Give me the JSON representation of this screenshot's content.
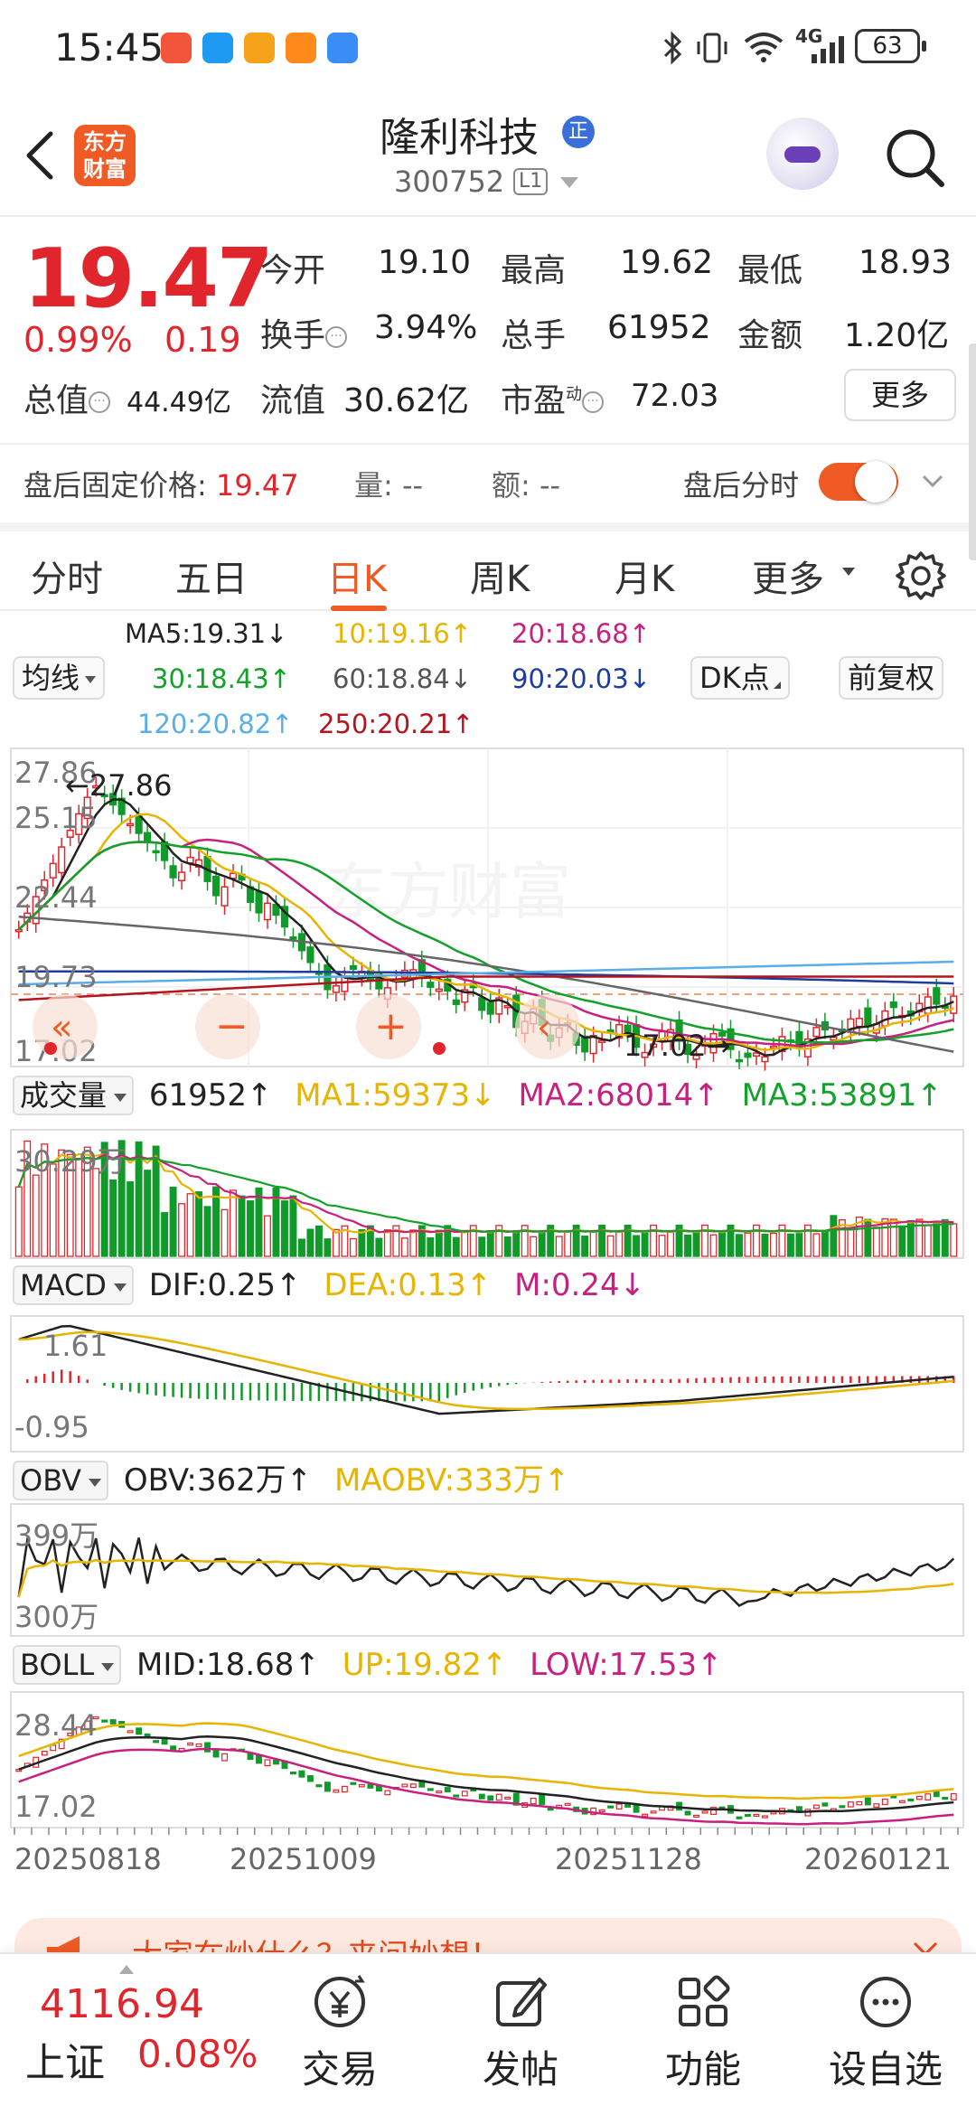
{
  "status_bar": {
    "time": "15:45",
    "network": "4G",
    "battery": "63"
  },
  "header": {
    "brand_logo": [
      "东方",
      "财富"
    ],
    "stock_name": "隆利科技",
    "badge": "正",
    "stock_code": "300752",
    "level": "L1"
  },
  "quote": {
    "price": "19.47",
    "change_pct": "0.99%",
    "change_abs": "0.19",
    "fields": [
      {
        "label": "今开",
        "value": "19.10",
        "color": "#109a2a"
      },
      {
        "label": "最高",
        "value": "19.62",
        "color": "#e0262c"
      },
      {
        "label": "最低",
        "value": "18.93",
        "color": "#109a2a"
      },
      {
        "label": "换手",
        "value": "3.94%",
        "color": "#222222"
      },
      {
        "label": "总手",
        "value": "61952",
        "color": "#222222"
      },
      {
        "label": "金额",
        "value": "1.20亿",
        "color": "#222222"
      }
    ],
    "total_mv_label": "总值",
    "total_mv": "44.49亿",
    "float_mv_label": "流值",
    "float_mv": "30.62亿",
    "pe_label": "市盈",
    "pe_sup": "动",
    "pe": "72.03",
    "more_button": "更多"
  },
  "after_hours": {
    "label": "盘后固定价格:",
    "price": "19.47",
    "volume_label": "量: --",
    "amount_label": "额: --",
    "toggle_label": "盘后分时",
    "toggle_on": true
  },
  "tabs": [
    "分时",
    "五日",
    "日K",
    "周K",
    "月K",
    "更多"
  ],
  "active_tab": "日K",
  "ma_legend": {
    "ma_select": "均线",
    "dk_button": "DK点",
    "adjust_button": "前复权",
    "items": [
      {
        "text": "MA5:19.31↓",
        "color": "#222222"
      },
      {
        "text": "10:19.16↑",
        "color": "#e7b400"
      },
      {
        "text": "20:18.68↑",
        "color": "#c8207f"
      },
      {
        "text": "30:18.43↑",
        "color": "#13a12a"
      },
      {
        "text": "60:18.84↓",
        "color": "#555555"
      },
      {
        "text": "90:20.03↓",
        "color": "#1d3e9c"
      },
      {
        "text": "120:20.82↑",
        "color": "#5aaee8"
      },
      {
        "text": "250:20.21↑",
        "color": "#b3141e"
      }
    ]
  },
  "kline": {
    "axis_labels": [
      "27.86",
      "25.15",
      "22.44",
      "19.73",
      "17.02"
    ],
    "high_marker": "←27.86",
    "low_marker": "17.02→"
  },
  "volume": {
    "select": "成交量",
    "value": "61952↑",
    "ma1": "MA1:59373↓",
    "ma2": "MA2:68014↑",
    "ma3": "MA3:53891↑",
    "axis_label": "30.29万"
  },
  "macd": {
    "select": "MACD",
    "dif": "DIF:0.25↑",
    "dea": "DEA:0.13↑",
    "m": "M:0.24↓",
    "axis_top": "1.61",
    "axis_bottom": "-0.95"
  },
  "obv": {
    "select": "OBV",
    "obv": "OBV:362万↑",
    "maobv": "MAOBV:333万↑",
    "axis_top": "399万",
    "axis_bottom": "300万"
  },
  "boll": {
    "select": "BOLL",
    "mid": "MID:18.68↑",
    "up": "UP:19.82↑",
    "low": "LOW:17.53↑",
    "axis_top": "28.44",
    "axis_bottom": "17.02"
  },
  "dates": [
    "20250818",
    "20251009",
    "20251128",
    "20260121"
  ],
  "banner": {
    "text": "大家在炒什么？来问妙想！"
  },
  "bottom_bar": {
    "index_value": "4116.94",
    "index_name": "上证",
    "index_pct": "0.08%",
    "items": [
      {
        "label": "交易",
        "icon": "trade-icon"
      },
      {
        "label": "发帖",
        "icon": "post-icon"
      },
      {
        "label": "功能",
        "icon": "function-icon"
      },
      {
        "label": "设自选",
        "icon": "watchlist-icon"
      }
    ]
  },
  "colors": {
    "accent": "#f05a24",
    "up": "#e0262c",
    "down": "#109a2a"
  }
}
